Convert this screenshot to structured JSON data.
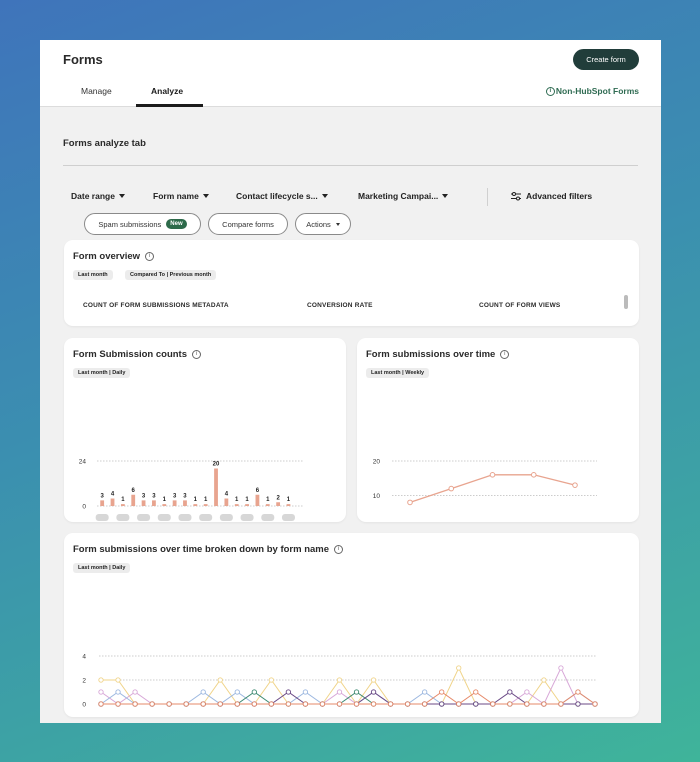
{
  "header": {
    "title": "Forms",
    "create_label": "Create form",
    "tabs": [
      {
        "label": "Manage"
      },
      {
        "label": "Analyze"
      }
    ],
    "non_hubspot_label": "Non-HubSpot Forms"
  },
  "section": {
    "title": "Forms analyze tab"
  },
  "filters": [
    {
      "label": "Date range"
    },
    {
      "label": "Form name"
    },
    {
      "label": "Contact lifecycle s..."
    },
    {
      "label": "Marketing Campai..."
    }
  ],
  "advanced_filters_label": "Advanced filters",
  "pills": {
    "spam": "Spam submissions",
    "new_badge": "New",
    "compare": "Compare forms",
    "actions": "Actions"
  },
  "overview": {
    "title": "Form overview",
    "tags": [
      "Last month",
      "Compared To | Previous month"
    ],
    "columns": [
      "COUNT OF FORM SUBMISSIONS METADATA",
      "CONVERSION RATE",
      "COUNT OF FORM VIEWS"
    ]
  },
  "submission_counts": {
    "title": "Form Submission counts",
    "tag": "Last month | Daily"
  },
  "submissions_over_time": {
    "title": "Form submissions over time",
    "tag": "Last month | Weekly"
  },
  "broken_down": {
    "title": "Form submissions over time broken down by form name",
    "tag": "Last month | Daily"
  },
  "colors": {
    "accent_dark": "#213d3a",
    "bar": "#e8a48f",
    "line": "#e8a48f",
    "link": "#2f6b52"
  },
  "icons": [
    "info-icon",
    "filter-sliders-icon",
    "caret-down-icon"
  ],
  "chart_data": [
    {
      "type": "bar",
      "title": "Form Submission counts",
      "categories": [
        "",
        "",
        "",
        "",
        "",
        "",
        "",
        "",
        "",
        "",
        "",
        "",
        "",
        "",
        "",
        "",
        "",
        "",
        "",
        ""
      ],
      "values": [
        3,
        4,
        1,
        6,
        3,
        3,
        1,
        3,
        3,
        1,
        1,
        20,
        4,
        1,
        1,
        6,
        1,
        2,
        1,
        0
      ],
      "ylim": [
        0,
        24
      ],
      "yticks": [
        0,
        24
      ],
      "grid": true
    },
    {
      "type": "line",
      "title": "Form submissions over time",
      "categories": [
        "",
        "",
        "",
        "",
        ""
      ],
      "values": [
        8,
        12,
        16,
        16,
        13
      ],
      "ylim": [
        0,
        20
      ],
      "yticks": [
        0,
        10,
        20
      ],
      "grid": true
    },
    {
      "type": "line",
      "title": "Form submissions over time broken down by form name",
      "ylim": [
        0,
        4
      ],
      "yticks": [
        0,
        2,
        4
      ],
      "grid": true,
      "points": 30,
      "series": [
        {
          "color": "#e8a48f",
          "values": [
            0,
            0,
            0,
            0,
            0,
            0,
            0,
            0,
            0,
            0,
            0,
            0,
            0,
            0,
            0,
            0,
            0,
            0,
            0,
            0,
            0,
            0,
            0,
            0,
            0,
            0,
            0,
            0,
            0,
            0
          ]
        },
        {
          "color": "#f0d48a",
          "values": [
            2,
            2,
            0,
            0,
            0,
            0,
            0,
            2,
            0,
            0,
            2,
            0,
            0,
            0,
            2,
            0,
            2,
            0,
            0,
            0,
            0,
            3,
            0,
            0,
            0,
            0,
            2,
            0,
            0,
            0
          ]
        },
        {
          "color": "#d8a8d8",
          "values": [
            1,
            0,
            1,
            0,
            0,
            0,
            0,
            0,
            0,
            0,
            0,
            0,
            0,
            0,
            1,
            0,
            0,
            0,
            0,
            0,
            0,
            0,
            0,
            0,
            0,
            1,
            0,
            3,
            0,
            0
          ]
        },
        {
          "color": "#9db8e0",
          "values": [
            0,
            1,
            0,
            0,
            0,
            0,
            1,
            0,
            1,
            0,
            0,
            0,
            1,
            0,
            0,
            0,
            1,
            0,
            0,
            1,
            0,
            0,
            0,
            0,
            0,
            0,
            0,
            0,
            1,
            0
          ]
        },
        {
          "color": "#3e8a72",
          "values": [
            0,
            0,
            0,
            0,
            0,
            0,
            0,
            0,
            0,
            1,
            0,
            0,
            0,
            0,
            0,
            1,
            0,
            0,
            0,
            0,
            0,
            0,
            0,
            0,
            0,
            0,
            0,
            0,
            0,
            0
          ]
        },
        {
          "color": "#6b4a86",
          "values": [
            0,
            0,
            0,
            0,
            0,
            0,
            0,
            0,
            0,
            0,
            0,
            1,
            0,
            0,
            0,
            0,
            1,
            0,
            0,
            0,
            0,
            0,
            0,
            0,
            1,
            0,
            0,
            0,
            0,
            0
          ]
        },
        {
          "color": "#e68a6a",
          "values": [
            0,
            0,
            0,
            0,
            0,
            0,
            0,
            0,
            0,
            0,
            0,
            0,
            0,
            0,
            0,
            0,
            0,
            0,
            0,
            0,
            1,
            0,
            1,
            0,
            0,
            0,
            0,
            0,
            1,
            0
          ]
        }
      ]
    }
  ]
}
